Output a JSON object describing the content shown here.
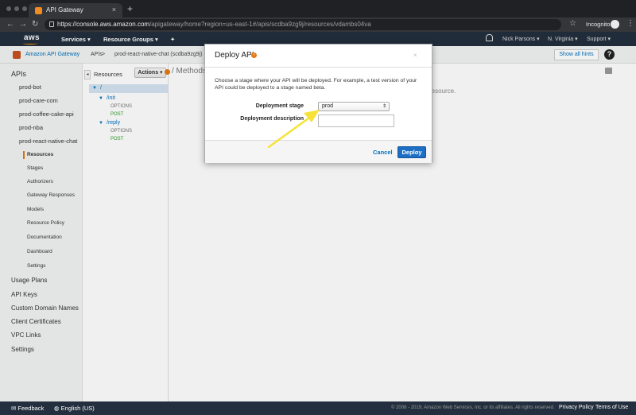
{
  "browser": {
    "tab_title": "API Gateway",
    "url_main": "https://console.aws.amazon.com",
    "url_rest": "/apigateway/home?region=us-east-1#/apis/scdba9zg9j/resources/vdambs04va",
    "incognito": "Incognito"
  },
  "aws_header": {
    "logo": "aws",
    "services": "Services",
    "resource_groups": "Resource Groups",
    "user": "Nick Parsons",
    "region": "N. Virginia",
    "support": "Support"
  },
  "breadcrumb": {
    "service": "Amazon API Gateway",
    "apis": "APIs",
    "api_name": "prod-react-native-chat (scdba9zg9j)",
    "show_hints": "Show all hints"
  },
  "sidebar": {
    "title": "APIs",
    "apis": [
      "prod-bot",
      "prod-care-com",
      "prod-coffee-cake-api",
      "prod-nba",
      "prod-react-native-chat"
    ],
    "subitems": [
      "Resources",
      "Stages",
      "Authorizers",
      "Gateway Responses",
      "Models",
      "Resource Policy",
      "Documentation",
      "Dashboard",
      "Settings"
    ],
    "sections": [
      "Usage Plans",
      "API Keys",
      "Custom Domain Names",
      "Client Certificates",
      "VPC Links",
      "Settings"
    ]
  },
  "resources": {
    "title": "Resources",
    "actions": "Actions",
    "root": "/",
    "init": "/init",
    "reply": "/reply",
    "options": "OPTIONS",
    "post": "POST"
  },
  "main": {
    "methods_title": "/ Methods",
    "resource_text": "resource."
  },
  "modal": {
    "title": "Deploy API",
    "description": "Choose a stage where your API will be deployed. For example, a test version of your API could be deployed to a stage named beta.",
    "stage_label": "Deployment stage",
    "stage_value": "prod",
    "desc_label": "Deployment description",
    "cancel": "Cancel",
    "deploy": "Deploy"
  },
  "footer": {
    "feedback": "Feedback",
    "language": "English (US)",
    "copyright": "© 2008 - 2019, Amazon Web Services, Inc. or its affiliates. All rights reserved.",
    "privacy": "Privacy Policy",
    "terms": "Terms of Use"
  },
  "colors": {
    "aws_dark": "#232f3e",
    "accent_orange": "#e47911",
    "link_blue": "#0073bb",
    "deploy_blue": "#1d6fc5",
    "annotation_arrow": "#f5e33a"
  }
}
